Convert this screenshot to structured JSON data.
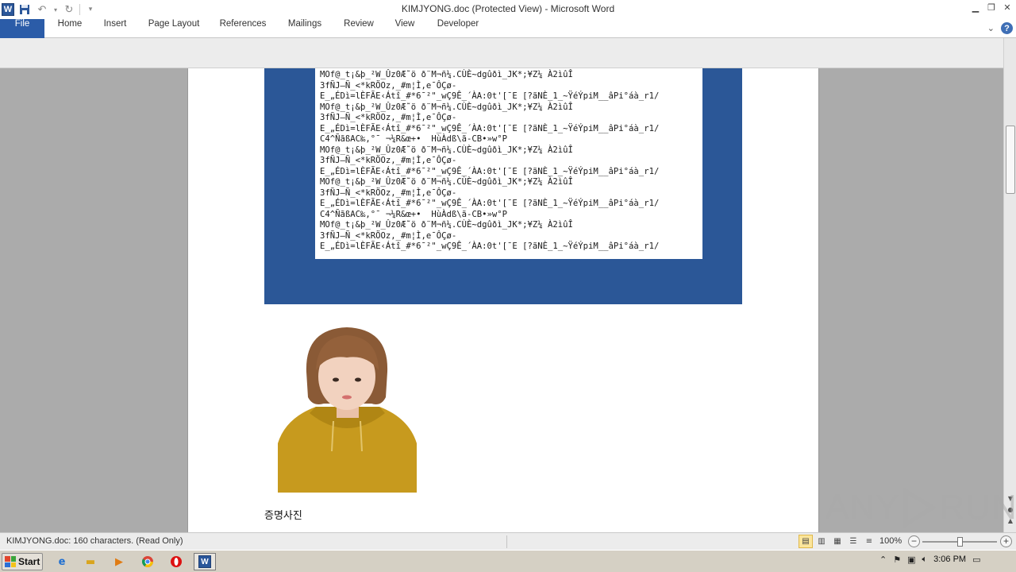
{
  "window": {
    "title": "KIMJYONG.doc (Protected View)  -  Microsoft Word"
  },
  "qat": {
    "app_icon_letter": "W"
  },
  "ribbon": {
    "tabs": [
      {
        "label": "File"
      },
      {
        "label": "Home"
      },
      {
        "label": "Insert"
      },
      {
        "label": "Page Layout"
      },
      {
        "label": "References"
      },
      {
        "label": "Mailings"
      },
      {
        "label": "Review"
      },
      {
        "label": "View"
      },
      {
        "label": "Developer"
      }
    ],
    "help_label": "?"
  },
  "document": {
    "garbled_lines": [
      "MOf@_t¡&þ_²W_Ûz0Æ˜ö ð¨M¬ñ¼.CÙÈ~dgûðì_JK*;¥Z¼ À2ìûÎ",
      "3fÑJ—Ñ_<*kRÖOz,_#m¦Ì,e¯ÔÇø-",
      "E_„ÉDì=lÈFÃE‹Átî_#*6¯²\"_wÇ9Ê_´ÀA:0t'[¯E [?ãNÈ_1_~ŸéÝpiM__âPi°áà_r1/",
      "MOf@_t¡&þ_²W_Ûz0Æ˜ö ð¨M¬ñ¼.CÙÈ~dgûðì_JK*;¥Z¼ À2ìûÎ",
      "3fÑJ—Ñ_<*kRÖOz,_#m¦Ì,e¯ÔÇø-",
      "E_„ÉDì=lÈFÃE‹Átî_#*6¯²\"_wÇ9Ê_´ÀA:0t'[¯E [?ãNÈ_1_~ŸéÝpiM__âPi°áà_r1/",
      "C4^ÑãßAC‰,°¯ ¬¼R&œ+•  HùÀdß\\ã-CB•»w°P",
      "MOf@_t¡&þ_²W_Ûz0Æ˜ö ð¨M¬ñ¼.CÙÈ~dgûðì_JK*;¥Z¼ À2ìûÎ",
      "3fÑJ—Ñ_<*kRÖOz,_#m¦Ì,e¯ÔÇø-",
      "E_„ÉDì=lÈFÃE‹Átî_#*6¯²\"_wÇ9Ê_´ÀA:0t'[¯E [?ãNÈ_1_~ŸéÝpiM__âPi°áà_r1/",
      "MOf@_t¡&þ_²W_Ûz0Æ˜ö ð¨M¬ñ¼.CÙÈ~dgûðì_JK*;¥Z¼ À2ìûÎ",
      "3fÑJ—Ñ_<*kRÖOz,_#m¦Ì,e¯ÔÇø-",
      "E_„ÉDì=lÈFÃE‹Átî_#*6¯²\"_wÇ9Ê_´ÀA:0t'[¯E [?ãNÈ_1_~ŸéÝpiM__âPi°áà_r1/",
      "C4^ÑãßAC‰,°¯ ¬¼R&œ+•  HùÀdß\\ã-CB•»w°P",
      "MOf@_t¡&þ_²W_Ûz0Æ˜ö ð¨M¬ñ¼.CÙÈ~dgûðì_JK*;¥Z¼ À2ìûÎ",
      "3fÑJ—Ñ_<*kRÖOz,_#m¦Ì,e¯ÔÇø-",
      "E_„ÉDì=lÈFÃE‹Átî_#*6¯²\"_wÇ9Ê_´ÀA:0t'[¯E [?ãNÈ_1_~ŸéÝpiM__âPi°áà_r1/"
    ],
    "photo_caption": "증명사진",
    "accent_block_color": "#2b5797"
  },
  "statusbar": {
    "text": "KIMJYONG.doc: 160 characters.  (Read Only)",
    "zoom": "100%",
    "zoom_minus": "−",
    "zoom_plus": "+"
  },
  "taskbar": {
    "start_label": "Start",
    "clock": "3:06 PM"
  },
  "watermark": {
    "text_left": "ANY",
    "text_right": "RUN"
  }
}
